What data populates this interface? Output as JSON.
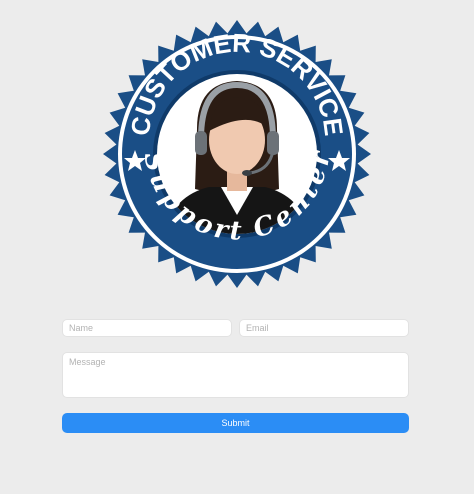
{
  "badge": {
    "line_top": "CUSTOMER SERVICE",
    "line_bottom": "Support Center",
    "colors": {
      "navy": "#1a4e86",
      "ring_dark": "#0f3a69",
      "white": "#ffffff",
      "headset": "#9aa0a6",
      "hair": "#2b1c14",
      "skin": "#f0c9b0",
      "suit": "#151515"
    }
  },
  "form": {
    "name_placeholder": "Name",
    "email_placeholder": "Email",
    "message_placeholder": "Message",
    "submit_label": "Submit",
    "accent": "#2b8df5"
  }
}
